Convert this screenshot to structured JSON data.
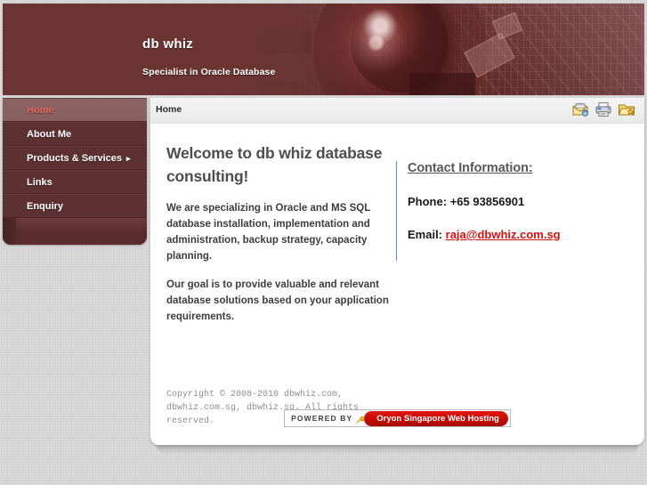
{
  "site": {
    "title": "db whiz",
    "tagline": "Specialist in Oracle Database"
  },
  "sidebar": {
    "items": [
      {
        "label": "Home",
        "active": true,
        "has_submenu": false
      },
      {
        "label": "About Me",
        "active": false,
        "has_submenu": false
      },
      {
        "label": "Products & Services",
        "active": false,
        "has_submenu": true,
        "caret": "▸"
      },
      {
        "label": "Links",
        "active": false,
        "has_submenu": false
      },
      {
        "label": "Enquiry",
        "active": false,
        "has_submenu": false
      }
    ]
  },
  "main": {
    "breadcrumb": "Home",
    "tools": [
      {
        "name": "email-page-icon",
        "title": "Email this page"
      },
      {
        "name": "print-page-icon",
        "title": "Print this page"
      },
      {
        "name": "bookmark-page-icon",
        "title": "Bookmark this page"
      }
    ],
    "heading": "Welcome to db whiz database consulting!",
    "paragraphs": [
      "We are specializing in Oracle and MS SQL database installation, implementation and administration, backup strategy, capacity planning.",
      "Our goal is to provide valuable and relevant database solutions based on your application requirements."
    ],
    "copyright": "Copyright © 2008-2010 dbwhiz.com, dbwhiz.com.sg, dbwhiz.sg. All rights reserved."
  },
  "contact": {
    "heading": "Contact Information:",
    "phone_label": "Phone:",
    "phone_value": "+65 93856901",
    "email_label": "Email:",
    "email_value": "raja@dbwhiz.com.sg"
  },
  "powered": {
    "label": "POWERED BY",
    "host": "Oryon Singapore Web Hosting"
  },
  "colors": {
    "header_maroon": "#6b3433",
    "nav_item": "#5d3131",
    "nav_active_bg": "#88615f",
    "nav_active_text": "#e8655a",
    "page_bg": "#d2d2d2",
    "link_red": "#d81010",
    "divider_blue": "#5f86c7",
    "badge_red": "#c20b05"
  }
}
